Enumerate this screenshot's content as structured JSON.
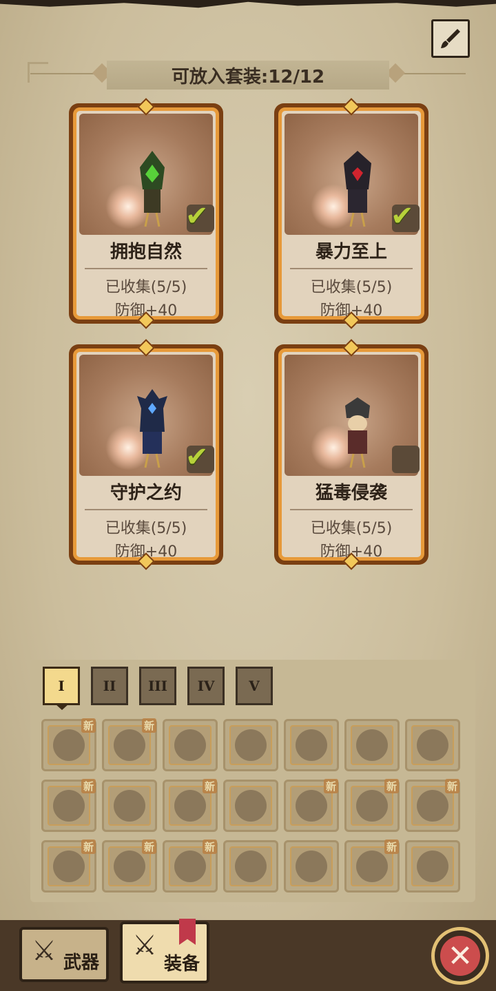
{
  "header": {
    "title": "可放入套装:12/12"
  },
  "sets": [
    {
      "name": "拥抱自然",
      "collected": "已收集(5/5)",
      "bonus": "防御+40",
      "checked": true,
      "accent": "#3c8a3c"
    },
    {
      "name": "暴力至上",
      "collected": "已收集(5/5)",
      "bonus": "防御+40",
      "checked": true,
      "accent": "#a0202a"
    },
    {
      "name": "守护之约",
      "collected": "已收集(5/5)",
      "bonus": "防御+40",
      "checked": true,
      "accent": "#2b4fb0"
    },
    {
      "name": "猛毒侵袭",
      "collected": "已收集(5/5)",
      "bonus": "防御+40",
      "checked": false,
      "accent": "#4a4a4a"
    }
  ],
  "inventory": {
    "tabs": [
      "I",
      "II",
      "III",
      "IV",
      "V"
    ],
    "active_tab": "I",
    "new_label": "新",
    "rows": [
      [
        {
          "icon": "dagger-icon",
          "new": true
        },
        {
          "icon": "dagger-icon",
          "new": true
        },
        {
          "icon": "nature-helmet-icon",
          "new": false
        },
        {
          "icon": "horned-helmet-icon",
          "new": false
        },
        {
          "icon": "dark-armor-icon",
          "new": false
        },
        {
          "icon": "spiked-armor-icon",
          "new": false
        },
        {
          "icon": "green-armor-icon",
          "new": false
        }
      ],
      [
        {
          "icon": "chest-armor-icon",
          "new": true
        },
        {
          "icon": "beast-armor-icon",
          "new": false
        },
        {
          "icon": "leaf-armor-icon",
          "new": true
        },
        {
          "icon": "scale-armor-icon",
          "new": false
        },
        {
          "icon": "boots-icon",
          "new": true
        },
        {
          "icon": "gauntlet-icon",
          "new": true
        },
        {
          "icon": "claw-icon",
          "new": true
        }
      ],
      [
        {
          "icon": "bat-wing-icon",
          "new": true
        },
        {
          "icon": "bat-wing-icon",
          "new": true
        },
        {
          "icon": "bat-wing-icon",
          "new": true
        },
        {
          "icon": "serpent-ring-icon",
          "new": false
        },
        {
          "icon": "scorpion-icon",
          "new": false
        },
        {
          "icon": "scorpion-icon",
          "new": true
        },
        {
          "icon": "beast-mount-icon",
          "new": false
        }
      ]
    ]
  },
  "bottom_nav": {
    "weapon_label": "武器",
    "equipment_label": "装备",
    "active": "equipment"
  },
  "colors": {
    "check": "#b7d13a",
    "close": "#cc4d4d",
    "card_frame": "#e79a3a"
  }
}
